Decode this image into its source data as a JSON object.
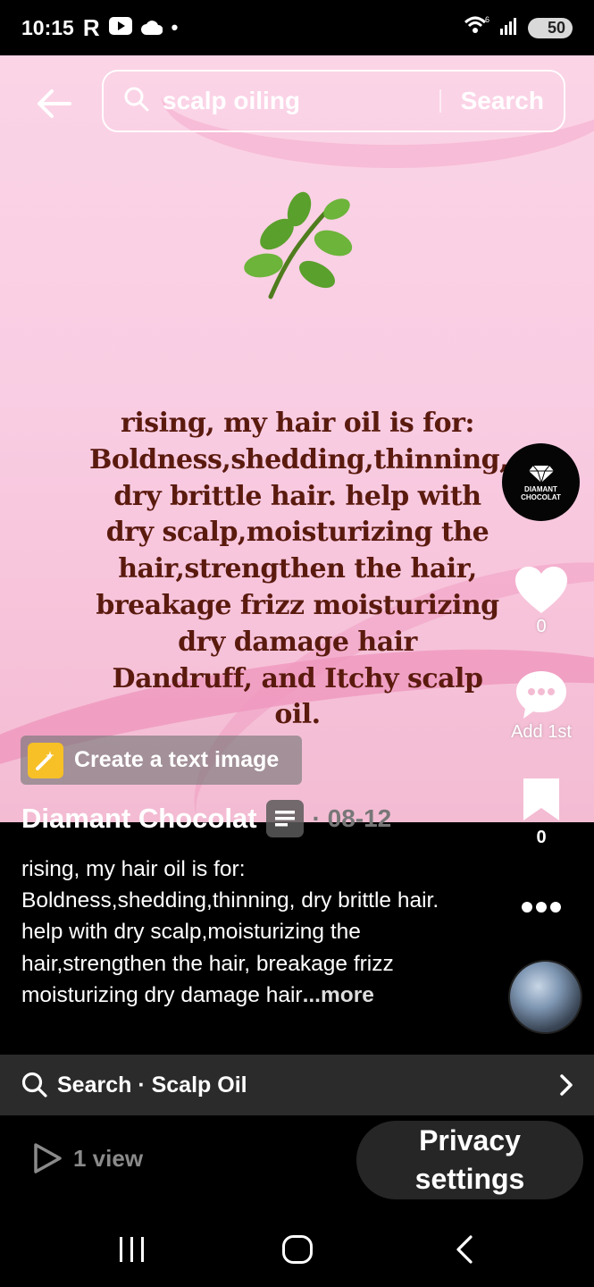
{
  "status_bar": {
    "time": "10:15",
    "battery": "50",
    "icons": [
      "r-app-icon",
      "youtube-icon",
      "cloud-icon",
      "dot-icon",
      "wifi-icon",
      "signal-icon",
      "battery-icon"
    ]
  },
  "search": {
    "query": "scalp oiling",
    "button_label": "Search"
  },
  "hero": {
    "emoji": "🌿",
    "text": "rising, my hair oil is for:\nBoldness,shedding,thinning,\ndry brittle hair. help with\ndry scalp,moisturizing the\nhair,strengthen the hair,\nbreakage frizz moisturizing\ndry damage hair\nDandruff, and Itchy scalp\noil.",
    "colors": {
      "background": "#f9cde3",
      "text": "#5a1a0e"
    }
  },
  "create_text_image": {
    "label": "Create a text image"
  },
  "author": {
    "name": "Diamant Chocolat",
    "date": "· 08-12",
    "avatar_text": "DIAMANT\nCHOCOLAT"
  },
  "caption": {
    "text": "rising, my hair oil is for: Boldness,shedding,thinning, dry brittle hair. help with dry scalp,moisturizing the hair,strengthen the hair, breakage frizz moisturizing dry damage hair",
    "more": "...more"
  },
  "actions": {
    "likes": "0",
    "comments": "Add 1st",
    "saves": "0"
  },
  "related_search": {
    "label": "Search · Scalp Oil"
  },
  "footer": {
    "views": "1 view",
    "privacy": "Privacy settings"
  }
}
